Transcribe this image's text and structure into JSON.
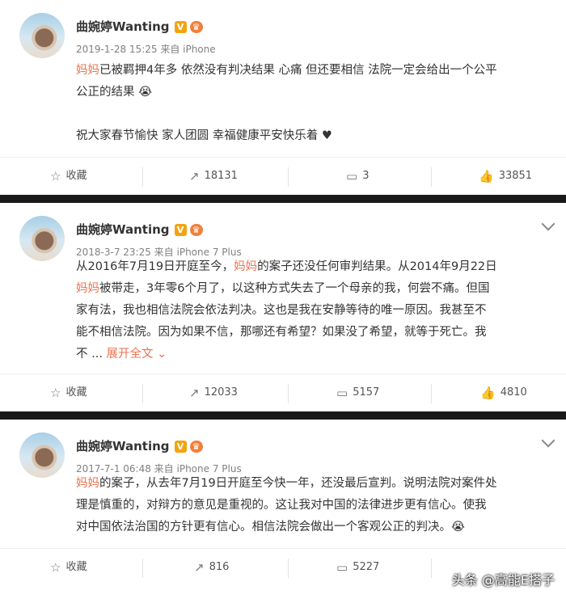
{
  "posts": [
    {
      "name": "曲婉婷Wanting",
      "meta": "2019-1-28 15:25 来自 iPhone",
      "lines": [
        [
          {
            "t": "妈妈",
            "h": true
          },
          {
            "t": "已被羁押4年多 依然没有判决结果 心痛 但还要相信 法院一定会给出一个公平"
          }
        ],
        [
          {
            "t": "公正的结果 😭",
            "h": false
          }
        ],
        [
          {
            "t": "",
            "h": false
          }
        ],
        [
          {
            "t": "祝大家春节愉快 家人团圆 幸福健康平安快乐着 ♥",
            "h": false
          }
        ]
      ],
      "actions": {
        "fav": "收藏",
        "repost": "18131",
        "comment": "3",
        "like": "33851"
      }
    },
    {
      "name": "曲婉婷Wanting",
      "meta": "2018-3-7 23:25 来自 iPhone 7 Plus",
      "lines": [
        [
          {
            "t": "从2016年7月19日开庭至今，",
            "h": false
          },
          {
            "t": "妈妈",
            "h": true
          },
          {
            "t": "的案子还没任何审判结果。从2014年9月22日",
            "h": false
          }
        ],
        [
          {
            "t": "妈妈",
            "h": true
          },
          {
            "t": "被带走，3年零6个月了，以这种方式失去了一个母亲的我，何尝不痛。但国",
            "h": false
          }
        ],
        [
          {
            "t": "家有法，我也相信法院会依法判决。这也是我在安静等待的唯一原因。我甚至不",
            "h": false
          }
        ],
        [
          {
            "t": "能不相信法院。因为如果不信，那哪还有希望？如果没了希望，就等于死亡。我",
            "h": false
          }
        ],
        [
          {
            "t": "不 ... ",
            "h": false
          },
          {
            "t": "展开全文 ⌄",
            "h": true
          }
        ]
      ],
      "actions": {
        "fav": "收藏",
        "repost": "12033",
        "comment": "5157",
        "like": "4810"
      }
    },
    {
      "name": "曲婉婷Wanting",
      "meta": "2017-7-1 06:48 来自 iPhone 7 Plus",
      "lines": [
        [
          {
            "t": "妈妈",
            "h": true
          },
          {
            "t": "的案子，从去年7月19日开庭至今快一年，还没最后宣判。说明法院对案件处",
            "h": false
          }
        ],
        [
          {
            "t": "理是慎重的，对辩方的意见是重视的。这让我对中国的法律进步更有信心。使我",
            "h": false
          }
        ],
        [
          {
            "t": "对中国依法治国的方针更有信心。相信法院会做出一个客观公正的判决。😭",
            "h": false
          }
        ]
      ],
      "actions": {
        "fav": "收藏",
        "repost": "816",
        "comment": "5227",
        "like": ""
      }
    }
  ],
  "badge_v": "V",
  "watermark": "头条 @高能E搭子"
}
